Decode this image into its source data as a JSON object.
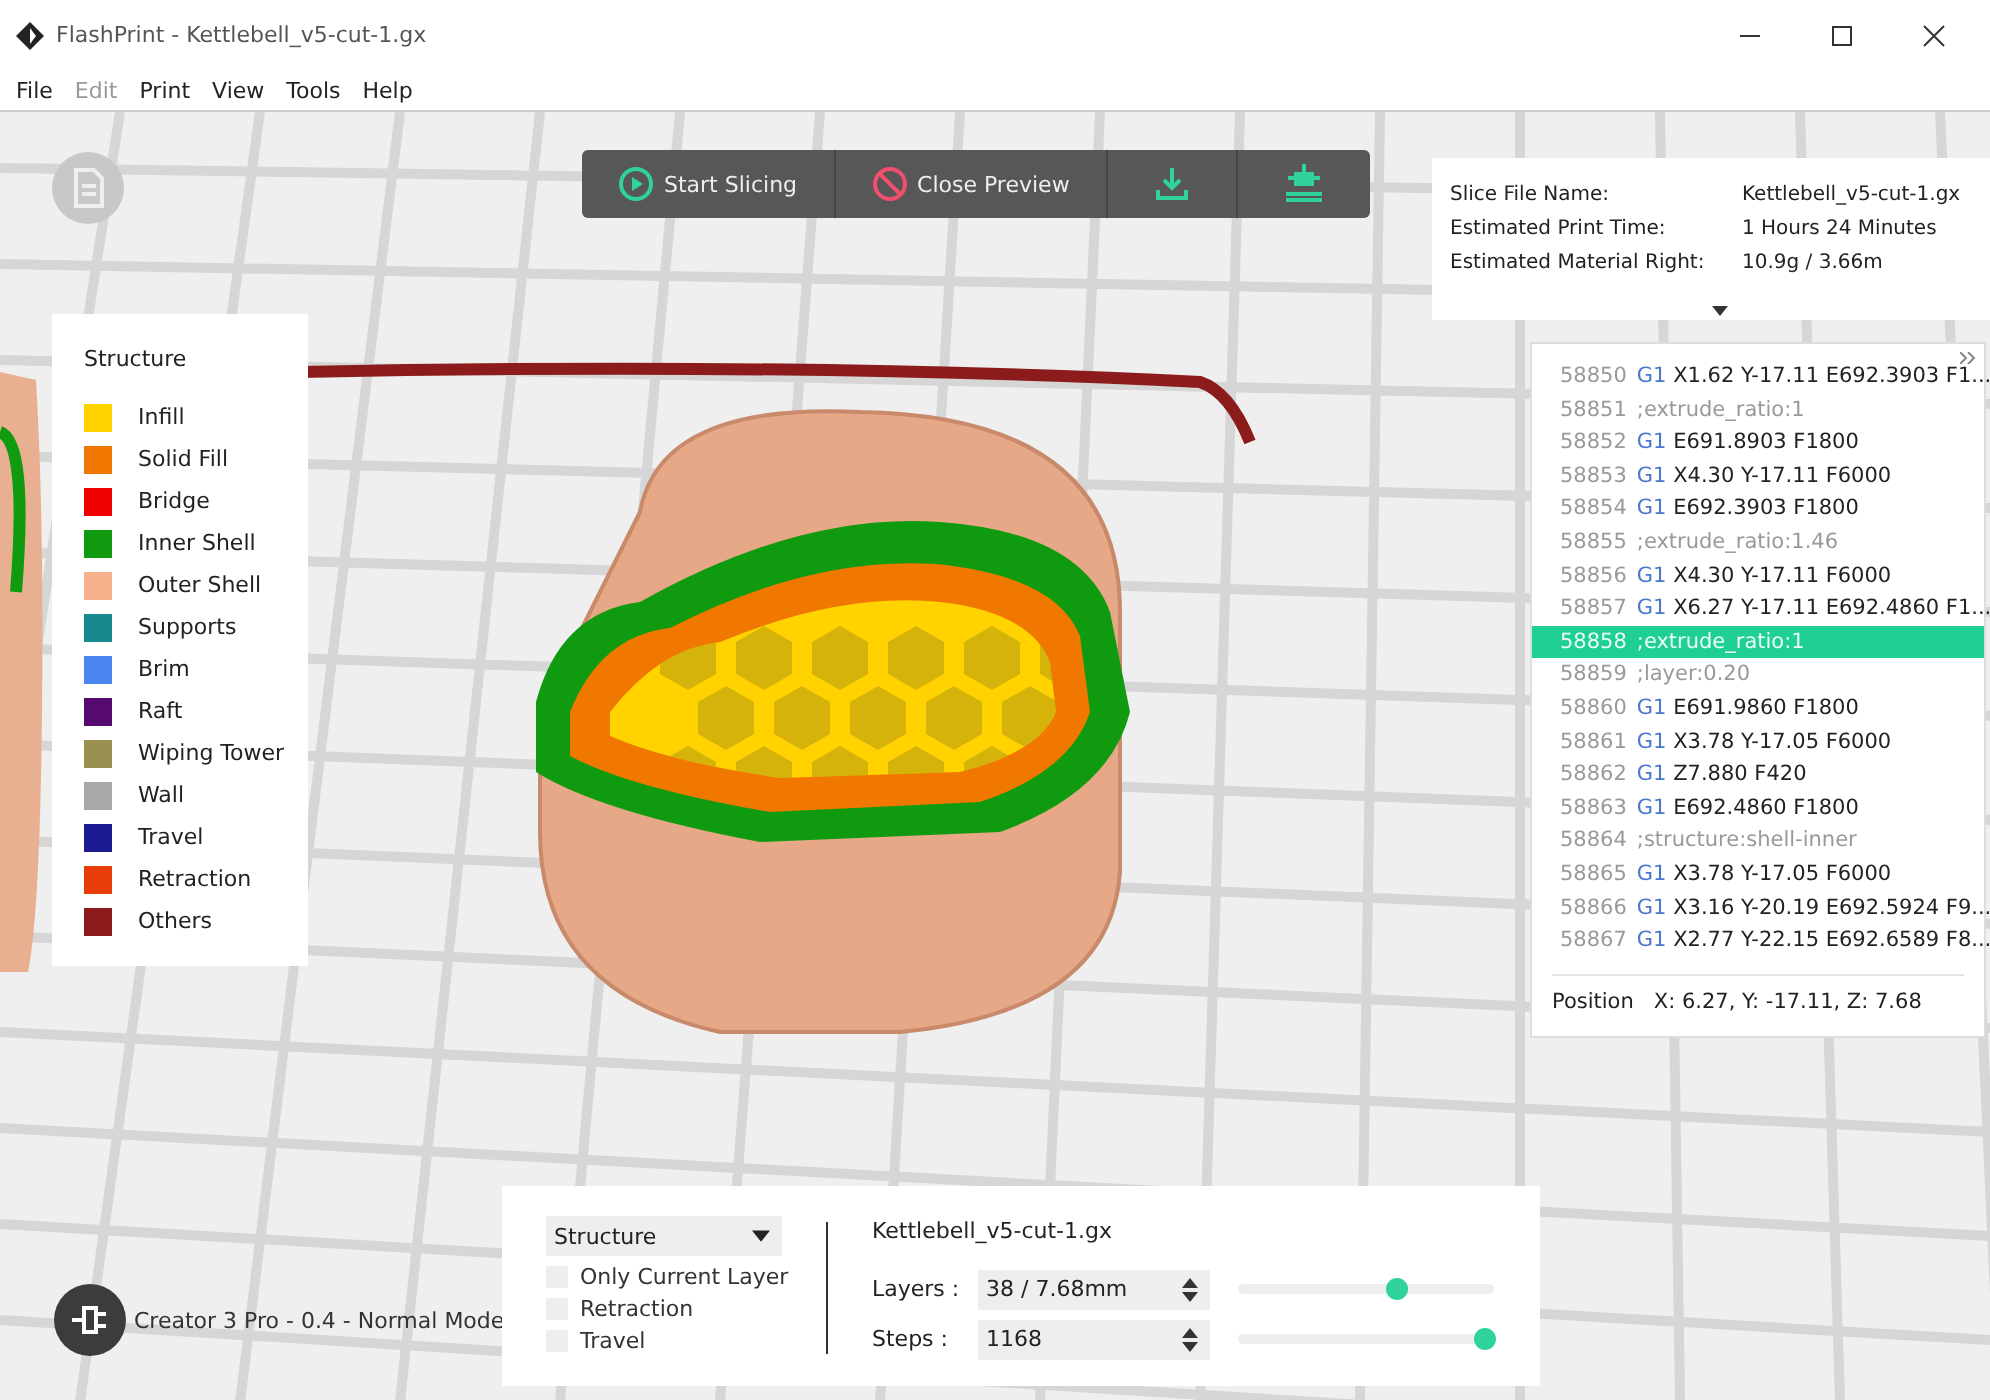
{
  "window": {
    "title": "FlashPrint - Kettlebell_v5-cut-1.gx"
  },
  "menu": [
    {
      "label": "File",
      "disabled": false
    },
    {
      "label": "Edit",
      "disabled": true
    },
    {
      "label": "Print",
      "disabled": false
    },
    {
      "label": "View",
      "disabled": false
    },
    {
      "label": "Tools",
      "disabled": false
    },
    {
      "label": "Help",
      "disabled": false
    }
  ],
  "toolbar": {
    "start_slicing": "Start Slicing",
    "close_preview": "Close Preview"
  },
  "slice_info": [
    {
      "label": "Slice File Name:",
      "value": "Kettlebell_v5-cut-1.gx"
    },
    {
      "label": "Estimated Print Time:",
      "value": "1 Hours 24 Minutes"
    },
    {
      "label": "Estimated Material Right:",
      "value": "10.9g / 3.66m"
    }
  ],
  "legend": {
    "title": "Structure",
    "items": [
      {
        "label": "Infill",
        "color": "#ffd200"
      },
      {
        "label": "Solid Fill",
        "color": "#f07800"
      },
      {
        "label": "Bridge",
        "color": "#ee0000"
      },
      {
        "label": "Inner Shell",
        "color": "#109a10"
      },
      {
        "label": "Outer Shell",
        "color": "#f5b08c"
      },
      {
        "label": "Supports",
        "color": "#168a8e"
      },
      {
        "label": "Brim",
        "color": "#4a86f0"
      },
      {
        "label": "Raft",
        "color": "#560a70"
      },
      {
        "label": "Wiping Tower",
        "color": "#9a9050"
      },
      {
        "label": "Wall",
        "color": "#a8a8a8"
      },
      {
        "label": "Travel",
        "color": "#1c1a90"
      },
      {
        "label": "Retraction",
        "color": "#e83c0a"
      },
      {
        "label": "Others",
        "color": "#8c1c1c"
      }
    ]
  },
  "gcode": {
    "lines": [
      {
        "number": "58850",
        "kind": "move",
        "command": "G1",
        "text": "X1.62 Y-17.11 E692.3903 F1...",
        "selected": false
      },
      {
        "number": "58851",
        "kind": "comment",
        "text": ";extrude_ratio:1",
        "selected": false
      },
      {
        "number": "58852",
        "kind": "move",
        "command": "G1",
        "text": "E691.8903 F1800",
        "selected": false
      },
      {
        "number": "58853",
        "kind": "move",
        "command": "G1",
        "text": "X4.30 Y-17.11 F6000",
        "selected": false
      },
      {
        "number": "58854",
        "kind": "move",
        "command": "G1",
        "text": "E692.3903 F1800",
        "selected": false
      },
      {
        "number": "58855",
        "kind": "comment",
        "text": ";extrude_ratio:1.46",
        "selected": false
      },
      {
        "number": "58856",
        "kind": "move",
        "command": "G1",
        "text": "X4.30 Y-17.11 F6000",
        "selected": false
      },
      {
        "number": "58857",
        "kind": "move",
        "command": "G1",
        "text": "X6.27 Y-17.11 E692.4860 F1...",
        "selected": false
      },
      {
        "number": "58858",
        "kind": "comment",
        "text": ";extrude_ratio:1",
        "selected": true
      },
      {
        "number": "58859",
        "kind": "comment",
        "text": ";layer:0.20",
        "selected": false
      },
      {
        "number": "58860",
        "kind": "move",
        "command": "G1",
        "text": "E691.9860 F1800",
        "selected": false
      },
      {
        "number": "58861",
        "kind": "move",
        "command": "G1",
        "text": "X3.78 Y-17.05 F6000",
        "selected": false
      },
      {
        "number": "58862",
        "kind": "move",
        "command": "G1",
        "text": "Z7.880 F420",
        "selected": false
      },
      {
        "number": "58863",
        "kind": "move",
        "command": "G1",
        "text": "E692.4860 F1800",
        "selected": false
      },
      {
        "number": "58864",
        "kind": "comment",
        "text": ";structure:shell-inner",
        "selected": false
      },
      {
        "number": "58865",
        "kind": "move",
        "command": "G1",
        "text": "X3.78 Y-17.05 F6000",
        "selected": false
      },
      {
        "number": "58866",
        "kind": "move",
        "command": "G1",
        "text": "X3.16 Y-20.19 E692.5924 F9...",
        "selected": false
      },
      {
        "number": "58867",
        "kind": "move",
        "command": "G1",
        "text": "X2.77 Y-22.15 E692.6589 F8...",
        "selected": false
      }
    ],
    "position_label": "Position",
    "position": "X: 6.27, Y: -17.11, Z: 7.68"
  },
  "printer": "Creator 3 Pro - 0.4 - Normal Mode",
  "preview": {
    "mode": "Structure",
    "options": [
      {
        "label": "Only Current Layer",
        "checked": false
      },
      {
        "label": "Retraction",
        "checked": false
      },
      {
        "label": "Travel",
        "checked": false
      }
    ],
    "file_name": "Kettlebell_v5-cut-1.gx",
    "layers": {
      "label": "Layers :",
      "value": "38 / 7.68mm",
      "level": 0.62
    },
    "steps": {
      "label": "Steps :",
      "value": "1168",
      "level": 0.96
    }
  }
}
